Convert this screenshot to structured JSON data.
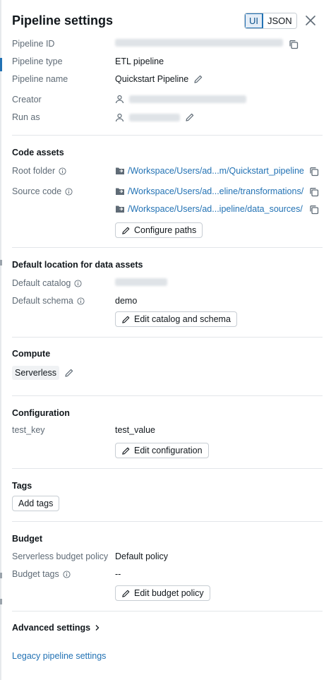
{
  "header": {
    "title": "Pipeline settings",
    "mode_tabs": [
      {
        "label": "UI",
        "active": true
      },
      {
        "label": "JSON",
        "active": false
      }
    ]
  },
  "details": {
    "pipeline_id_label": "Pipeline ID",
    "pipeline_type_label": "Pipeline type",
    "pipeline_type_value": "ETL pipeline",
    "pipeline_name_label": "Pipeline name",
    "pipeline_name_value": "Quickstart Pipeline",
    "creator_label": "Creator",
    "run_as_label": "Run as"
  },
  "code_assets": {
    "title": "Code assets",
    "root_folder_label": "Root folder",
    "root_folder_path": "/Workspace/Users/ad...m/Quickstart_pipeline",
    "source_code_label": "Source code",
    "source_paths": [
      "/Workspace/Users/ad...eline/transformations/",
      "/Workspace/Users/ad...ipeline/data_sources/"
    ],
    "configure_button": "Configure paths"
  },
  "default_location": {
    "title": "Default location for data assets",
    "catalog_label": "Default catalog",
    "schema_label": "Default schema",
    "schema_value": "demo",
    "edit_button": "Edit catalog and schema"
  },
  "compute": {
    "title": "Compute",
    "value": "Serverless"
  },
  "configuration": {
    "title": "Configuration",
    "key": "test_key",
    "value": "test_value",
    "edit_button": "Edit configuration"
  },
  "tags": {
    "title": "Tags",
    "add_button": "Add tags"
  },
  "budget": {
    "title": "Budget",
    "policy_label": "Serverless budget policy",
    "policy_value": "Default policy",
    "tags_label": "Budget tags",
    "tags_value": "--",
    "edit_button": "Edit budget policy"
  },
  "advanced": {
    "label": "Advanced settings"
  },
  "legacy": {
    "link": "Legacy pipeline settings"
  },
  "colors": {
    "accent": "#2272b4",
    "label_text": "#5f6b76",
    "border": "#c7cdd3"
  }
}
